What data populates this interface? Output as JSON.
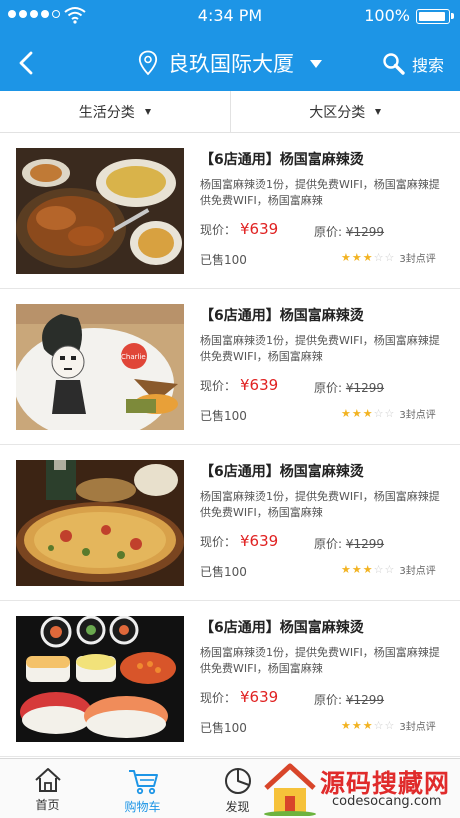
{
  "status": {
    "time": "4:34 PM",
    "battery": "100%"
  },
  "header": {
    "location": "良玖国际大厦",
    "search_label": "搜索"
  },
  "filters": [
    {
      "label": "生活分类"
    },
    {
      "label": "大区分类"
    }
  ],
  "items": [
    {
      "title": "【6店通用】杨国富麻辣烫",
      "desc": "杨国富麻辣烫1份，提供免费WIFI，杨国富麻辣提供免费WIFI，杨国富麻辣",
      "now_label": "现价：",
      "now_price": "¥639",
      "orig_label": "原价:",
      "orig_price": "¥1299",
      "sold": "已售100",
      "stars": 3,
      "reviews": "3封点评"
    },
    {
      "title": "【6店通用】杨国富麻辣烫",
      "desc": "杨国富麻辣烫1份，提供免费WIFI，杨国富麻辣提供免费WIFI，杨国富麻辣",
      "now_label": "现价：",
      "now_price": "¥639",
      "orig_label": "原价:",
      "orig_price": "¥1299",
      "sold": "已售100",
      "stars": 3,
      "reviews": "3封点评"
    },
    {
      "title": "【6店通用】杨国富麻辣烫",
      "desc": "杨国富麻辣烫1份，提供免费WIFI，杨国富麻辣提供免费WIFI，杨国富麻辣",
      "now_label": "现价：",
      "now_price": "¥639",
      "orig_label": "原价:",
      "orig_price": "¥1299",
      "sold": "已售100",
      "stars": 3,
      "reviews": "3封点评"
    },
    {
      "title": "【6店通用】杨国富麻辣烫",
      "desc": "杨国富麻辣烫1份，提供免费WIFI，杨国富麻辣提供免费WIFI，杨国富麻辣",
      "now_label": "现价：",
      "now_price": "¥639",
      "orig_label": "原价:",
      "orig_price": "¥1299",
      "sold": "已售100",
      "stars": 3,
      "reviews": "3封点评"
    }
  ],
  "tabs": [
    {
      "label": "首页"
    },
    {
      "label": "购物车"
    },
    {
      "label": "发现"
    }
  ],
  "watermark": {
    "text": "源码搜藏网",
    "url": "codesocang.com"
  },
  "colors": {
    "header": "#1d95e6",
    "price": "#e02222",
    "star": "#f2b322"
  }
}
